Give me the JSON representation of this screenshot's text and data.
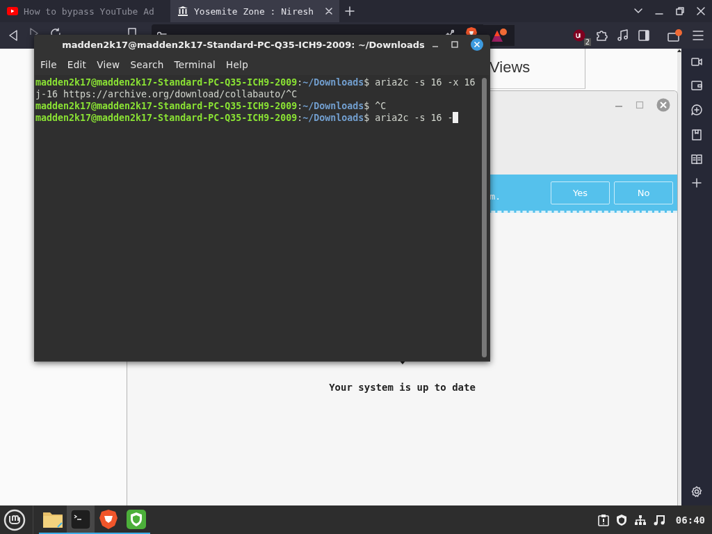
{
  "browser": {
    "tabs": [
      {
        "title": "How to bypass YouTube Ad",
        "kind": "video",
        "selected": false
      },
      {
        "title": "Yosemite Zone : Niresh",
        "kind": "archive",
        "selected": true
      }
    ],
    "extension_badge": "2",
    "page_heading": "Views"
  },
  "update_window": {
    "banner_text": "m.",
    "buttons": [
      "Yes",
      "No"
    ],
    "status": "Your system is up to date"
  },
  "terminal": {
    "title": "madden2k17@madden2k17-Standard-PC-Q35-ICH9-2009: ~/Downloads",
    "menu": [
      "File",
      "Edit",
      "View",
      "Search",
      "Terminal",
      "Help"
    ],
    "lines": [
      {
        "kind": "prompt",
        "user": "madden2k17@madden2k17-Standard-PC-Q35-ICH9-2009",
        "separator": ":",
        "path": "~/Downloads",
        "sigil": "$",
        "command": " aria2c -s 16 -x 16",
        "cursor": false
      },
      {
        "kind": "output",
        "text": "j-16 https://archive.org/download/collabauto/^C"
      },
      {
        "kind": "prompt",
        "user": "madden2k17@madden2k17-Standard-PC-Q35-ICH9-2009",
        "separator": ":",
        "path": "~/Downloads",
        "sigil": "$",
        "command": " ^C",
        "cursor": false
      },
      {
        "kind": "prompt",
        "user": "madden2k17@madden2k17-Standard-PC-Q35-ICH9-2009",
        "separator": ":",
        "path": "~/Downloads",
        "sigil": "$",
        "command": " aria2c -s 16 -",
        "cursor": true
      }
    ]
  },
  "taskbar": {
    "apps": [
      {
        "kind": "folder",
        "active": false
      },
      {
        "kind": "terminal",
        "active": true
      },
      {
        "kind": "lion",
        "active": false
      },
      {
        "kind": "shield",
        "active": false
      }
    ],
    "clock": "06:40"
  }
}
